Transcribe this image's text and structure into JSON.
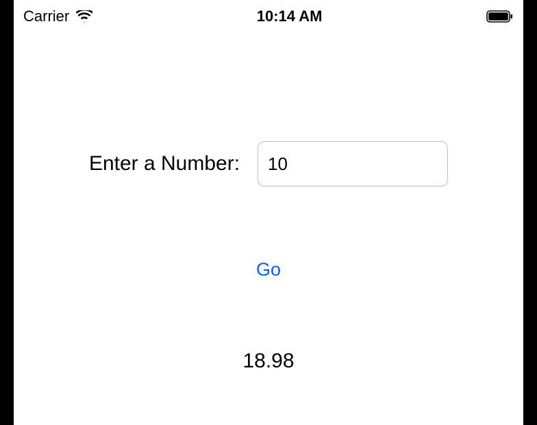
{
  "status_bar": {
    "carrier": "Carrier",
    "time": "10:14 AM"
  },
  "form": {
    "label": "Enter a Number:",
    "input_value": "10",
    "go_label": "Go",
    "result": "18.98"
  }
}
